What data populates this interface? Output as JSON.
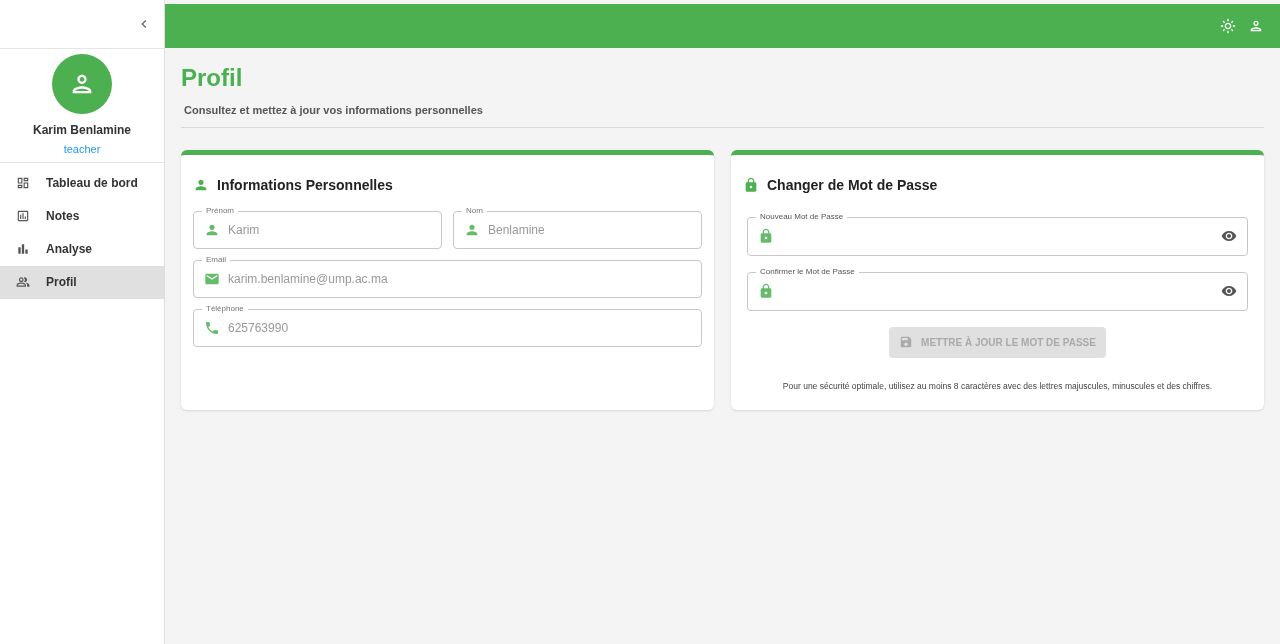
{
  "sidebar": {
    "user": {
      "name": "Karim Benlamine",
      "role": "teacher"
    },
    "items": [
      {
        "label": "Tableau de bord",
        "kind": "dashboard",
        "selected": false
      },
      {
        "label": "Notes",
        "kind": "notes",
        "selected": false
      },
      {
        "label": "Analyse",
        "kind": "analysis",
        "selected": false
      },
      {
        "label": "Profil",
        "kind": "profile",
        "selected": true
      }
    ]
  },
  "page": {
    "title": "Profil",
    "subtitle": "Consultez et mettez à jour vos informations personnelles"
  },
  "personal_card": {
    "title": "Informations Personnelles",
    "fields": [
      {
        "label": "Prénom",
        "value": "Karim",
        "kind": "person"
      },
      {
        "label": "Nom",
        "value": "Benlamine",
        "kind": "person"
      },
      {
        "label": "Email",
        "value": "karim.benlamine@ump.ac.ma",
        "kind": "email"
      },
      {
        "label": "Téléphone",
        "value": "625763990",
        "kind": "phone"
      }
    ]
  },
  "password_card": {
    "title": "Changer de Mot de Passe",
    "fields": [
      {
        "label": "Nouveau Mot de Passe"
      },
      {
        "label": "Confirmer le Mot de Passe"
      }
    ],
    "button": {
      "label": "METTRE À JOUR LE MOT DE PASSE",
      "disabled": true
    },
    "hint": "Pour une sécurité optimale, utilisez au moins 8 caractères avec des lettres majuscules, minuscules et des chiffres."
  }
}
